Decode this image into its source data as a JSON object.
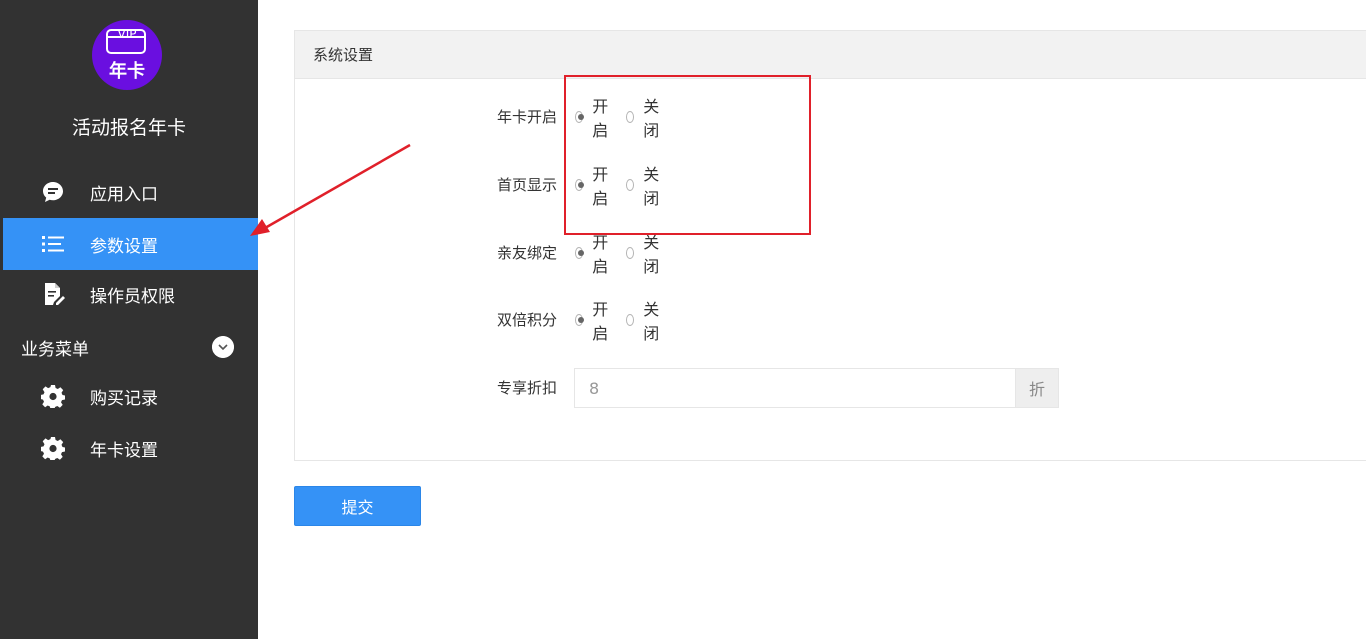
{
  "sidebar": {
    "logo": {
      "card_text": "VIP",
      "sub_text": "年卡"
    },
    "app_name": "活动报名年卡",
    "items": [
      {
        "label": "应用入口",
        "icon": "chat-bubble-icon",
        "active": false
      },
      {
        "label": "参数设置",
        "icon": "list-icon",
        "active": true
      },
      {
        "label": "操作员权限",
        "icon": "document-edit-icon",
        "active": false
      }
    ],
    "section": {
      "label": "业务菜单",
      "icon": "chevron-down-icon"
    },
    "section_items": [
      {
        "label": "购买记录",
        "icon": "gear-icon"
      },
      {
        "label": "年卡设置",
        "icon": "gear-icon"
      }
    ]
  },
  "panel": {
    "title": "系统设置",
    "rows": [
      {
        "label": "年卡开启",
        "on_label": "开启",
        "off_label": "关闭",
        "value": "on"
      },
      {
        "label": "首页显示",
        "on_label": "开启",
        "off_label": "关闭",
        "value": "on"
      },
      {
        "label": "亲友绑定",
        "on_label": "开启",
        "off_label": "关闭",
        "value": "on"
      },
      {
        "label": "双倍积分",
        "on_label": "开启",
        "off_label": "关闭",
        "value": "on"
      }
    ],
    "discount": {
      "label": "专享折扣",
      "value": "8",
      "suffix": "折"
    }
  },
  "submit_label": "提交",
  "colors": {
    "sidebar_bg": "#323232",
    "accent": "#3592f6",
    "annotation": "#e0202a",
    "logo_bg": "#6a0fe0"
  }
}
